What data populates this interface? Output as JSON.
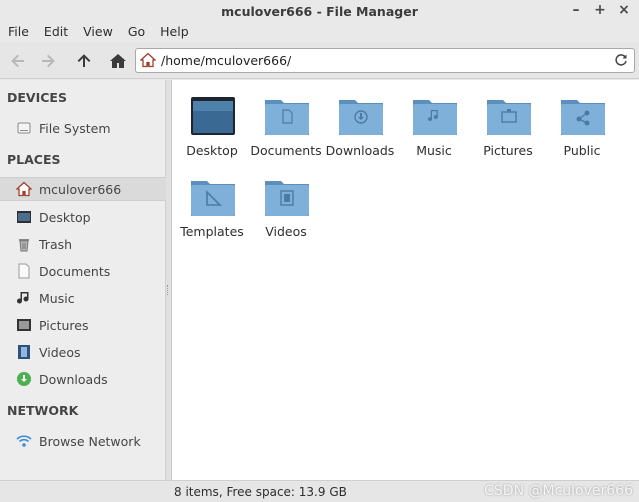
{
  "window": {
    "title": "mculover666 - File Manager",
    "controls": [
      "–",
      "+",
      "×"
    ]
  },
  "menu": [
    "File",
    "Edit",
    "View",
    "Go",
    "Help"
  ],
  "toolbar": {
    "buttons": [
      "back-arrow-icon",
      "forward-arrow-icon",
      "up-arrow-icon",
      "home-icon"
    ]
  },
  "location": {
    "path": "/home/mculover666/"
  },
  "sidebar": {
    "devices_label": "DEVICES",
    "devices": [
      {
        "label": "File System",
        "icon": "drive-icon"
      }
    ],
    "places_label": "PLACES",
    "places": [
      {
        "label": "mculover666",
        "icon": "home-icon",
        "selected": true
      },
      {
        "label": "Desktop",
        "icon": "desktop-icon"
      },
      {
        "label": "Trash",
        "icon": "trash-icon"
      },
      {
        "label": "Documents",
        "icon": "document-icon"
      },
      {
        "label": "Music",
        "icon": "music-icon"
      },
      {
        "label": "Pictures",
        "icon": "pictures-icon"
      },
      {
        "label": "Videos",
        "icon": "videos-icon"
      },
      {
        "label": "Downloads",
        "icon": "downloads-icon"
      }
    ],
    "network_label": "NETWORK",
    "network": [
      {
        "label": "Browse Network",
        "icon": "wifi-icon"
      }
    ]
  },
  "files": [
    {
      "label": "Desktop",
      "icon": "desktop-folder-icon"
    },
    {
      "label": "Documents",
      "icon": "documents-folder-icon"
    },
    {
      "label": "Downloads",
      "icon": "downloads-folder-icon"
    },
    {
      "label": "Music",
      "icon": "music-folder-icon"
    },
    {
      "label": "Pictures",
      "icon": "pictures-folder-icon"
    },
    {
      "label": "Public",
      "icon": "public-folder-icon"
    },
    {
      "label": "Templates",
      "icon": "templates-folder-icon"
    },
    {
      "label": "Videos",
      "icon": "videos-folder-icon"
    }
  ],
  "status": {
    "text": "8 items, Free space: 13.9 GB"
  },
  "watermark": "CSDN @Mculover666",
  "colors": {
    "folder": "#7fb0d9",
    "folder_dark": "#5a8fbe",
    "accent_green": "#4caf50",
    "wifi": "#3d8fd6"
  }
}
